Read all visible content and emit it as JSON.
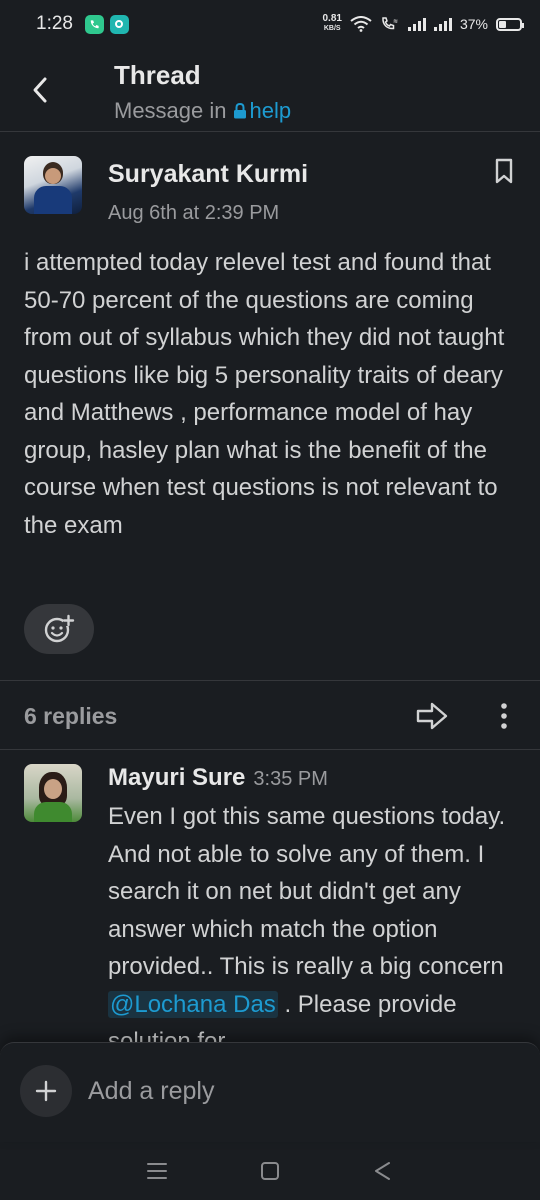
{
  "status_bar": {
    "time": "1:28",
    "net_speed": "0.81",
    "net_unit": "KB/S",
    "battery_pct": "37%",
    "battery_level": 0.37
  },
  "header": {
    "title": "Thread",
    "subtitle_prefix": "Message in",
    "channel": "help"
  },
  "parent_message": {
    "author": "Suryakant Kurmi",
    "timestamp": "Aug 6th at 2:39 PM",
    "text": "i attempted today relevel test and found that 50-70 percent of the questions are coming from out of syllabus which they did not taught questions like big 5 personality traits of deary and Matthews  , performance model of hay group, hasley plan what is the benefit of the course when test questions is not relevant to the exam"
  },
  "replies_bar": {
    "count_label": "6 replies"
  },
  "reply": {
    "author": "Mayuri Sure",
    "time": "3:35 PM",
    "text_before": "Even I got this same questions today. And not able to solve any of them. I search it on net but didn't get any answer which match the option provided.. This is really a big concern ",
    "mention": "@Lochana Das",
    "text_after": " . Please provide solution for"
  },
  "composer": {
    "placeholder": "Add a reply"
  },
  "icons": {
    "back": "chevron-left-icon",
    "lock": "lock-icon",
    "bookmark": "bookmark-icon",
    "reaction": "add-reaction-icon",
    "share": "arrow-right-icon",
    "more": "vertical-ellipsis-icon",
    "add": "plus-icon"
  },
  "colors": {
    "background": "#1a1d21",
    "link": "#1d9bd1",
    "text": "#d1d2d3",
    "muted": "#9a9b9e"
  }
}
